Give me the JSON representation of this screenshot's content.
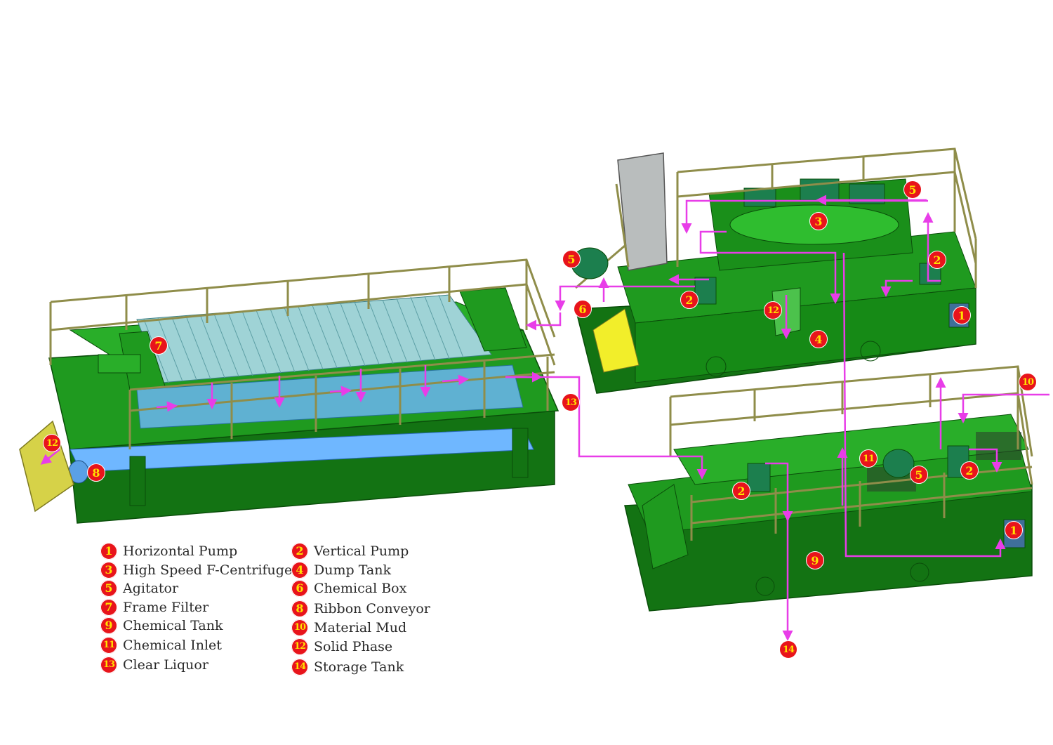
{
  "legend": [
    {
      "num": "1",
      "label": "Horizontal Pump"
    },
    {
      "num": "2",
      "label": "Vertical Pump"
    },
    {
      "num": "3",
      "label": "High Speed F-Centrifuge"
    },
    {
      "num": "4",
      "label": "Dump Tank"
    },
    {
      "num": "5",
      "label": "Agitator"
    },
    {
      "num": "6",
      "label": "Chemical Box"
    },
    {
      "num": "7",
      "label": "Frame Filter"
    },
    {
      "num": "8",
      "label": "Ribbon Conveyor"
    },
    {
      "num": "9",
      "label": "Chemical Tank"
    },
    {
      "num": "10",
      "label": "Material Mud"
    },
    {
      "num": "11",
      "label": "Chemical Inlet"
    },
    {
      "num": "12",
      "label": "Solid Phase"
    },
    {
      "num": "13",
      "label": "Clear Liquor"
    },
    {
      "num": "14",
      "label": "Storage Tank"
    }
  ],
  "callouts": [
    "7",
    "12",
    "8",
    "13",
    "5",
    "6",
    "3",
    "2",
    "12",
    "4",
    "5",
    "2",
    "1",
    "10",
    "11",
    "2",
    "5",
    "2",
    "1",
    "9",
    "14"
  ],
  "colors": {
    "frame_green": "#1f9a1f",
    "dark_green": "#137313",
    "light_green": "#4cc24c",
    "rail": "#8f8d4a",
    "flow_arrow": "#e83de8",
    "badge": "#e8141b",
    "badge_text": "#ffe300",
    "conveyor_blue": "#6fb7ff",
    "stair_yellow": "#f2ee2a",
    "panel_grey": "#b9bdbd"
  }
}
